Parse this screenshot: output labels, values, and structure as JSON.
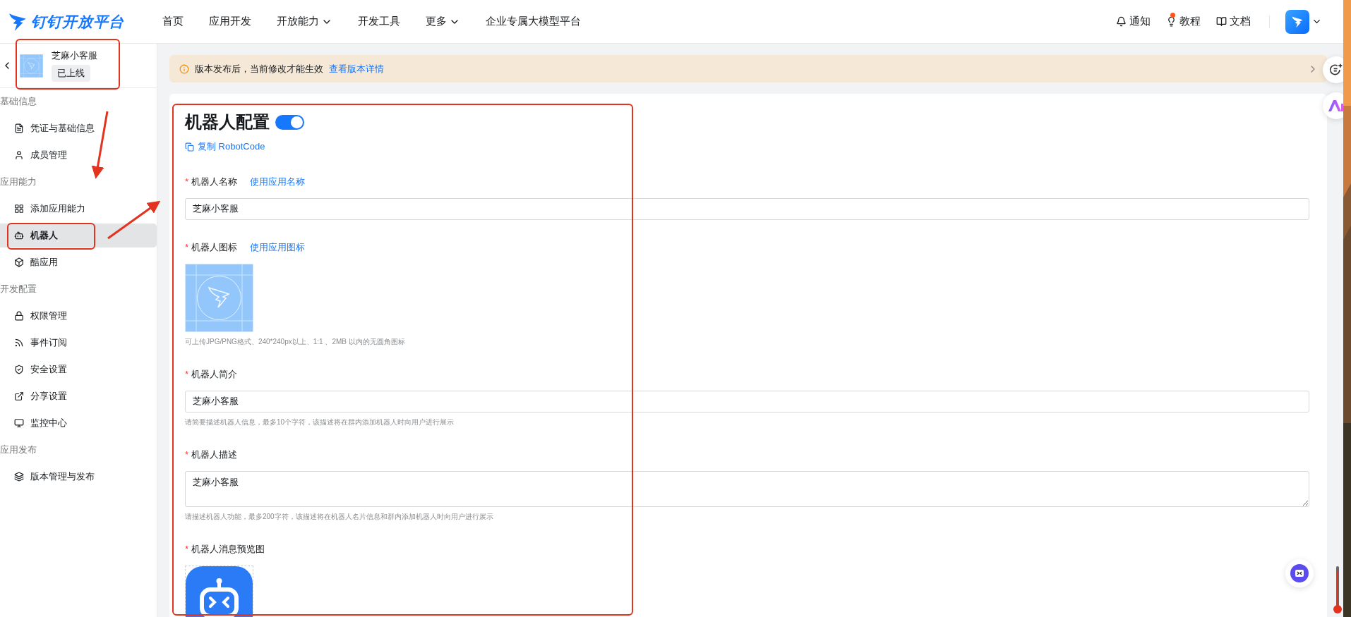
{
  "nav": {
    "brand": "钉钉开放平台",
    "items": [
      {
        "label": "首页",
        "dropdown": false
      },
      {
        "label": "应用开发",
        "dropdown": false
      },
      {
        "label": "开放能力",
        "dropdown": true
      },
      {
        "label": "开发工具",
        "dropdown": false
      },
      {
        "label": "更多",
        "dropdown": true
      },
      {
        "label": "企业专属大模型平台",
        "dropdown": false
      }
    ],
    "right": [
      {
        "label": "通知",
        "dot": false
      },
      {
        "label": "教程",
        "dot": true
      },
      {
        "label": "文档",
        "dot": false
      }
    ]
  },
  "app": {
    "name": "芝麻小客服",
    "status": "已上线"
  },
  "sidebar": {
    "sections": [
      {
        "title": "基础信息",
        "items": [
          {
            "label": "凭证与基础信息",
            "selected": false
          },
          {
            "label": "成员管理",
            "selected": false
          }
        ]
      },
      {
        "title": "应用能力",
        "items": [
          {
            "label": "添加应用能力",
            "selected": false
          },
          {
            "label": "机器人",
            "selected": true
          },
          {
            "label": "酷应用",
            "selected": false
          }
        ]
      },
      {
        "title": "开发配置",
        "items": [
          {
            "label": "权限管理",
            "selected": false
          },
          {
            "label": "事件订阅",
            "selected": false
          },
          {
            "label": "安全设置",
            "selected": false
          },
          {
            "label": "分享设置",
            "selected": false
          },
          {
            "label": "监控中心",
            "selected": false
          }
        ]
      },
      {
        "title": "应用发布",
        "items": [
          {
            "label": "版本管理与发布",
            "selected": false
          }
        ]
      }
    ]
  },
  "notice": {
    "text": "版本发布后，当前修改才能生效",
    "link": "查看版本详情"
  },
  "config": {
    "title": "机器人配置",
    "enabled": true,
    "copy_link": "复制 RobotCode",
    "fields": [
      {
        "kind": "input",
        "mark": "*",
        "label": "机器人名称",
        "action": "使用应用名称",
        "value": "芝麻小客服"
      },
      {
        "mark": "*",
        "label": "机器人图标",
        "action": "使用应用图标",
        "hint": "可上传JPG/PNG格式、240*240px以上、1:1 、2MB 以内的无圆角图标"
      },
      {
        "kind": "input",
        "mark": "*",
        "label": "机器人简介",
        "value": "芝麻小客服",
        "hint": "请简要描述机器人信息，最多10个字符，该描述将在群内添加机器人时向用户进行展示"
      },
      {
        "kind": "textarea",
        "mark": "*",
        "label": "机器人描述",
        "value": "芝麻小客服",
        "hint": "请描述机器人功能，最多200字符，该描述将在机器人名片信息和群内添加机器人时向用户进行展示"
      },
      {
        "kind": "preview",
        "mark": "*",
        "label": "机器人消息预览图"
      }
    ]
  }
}
